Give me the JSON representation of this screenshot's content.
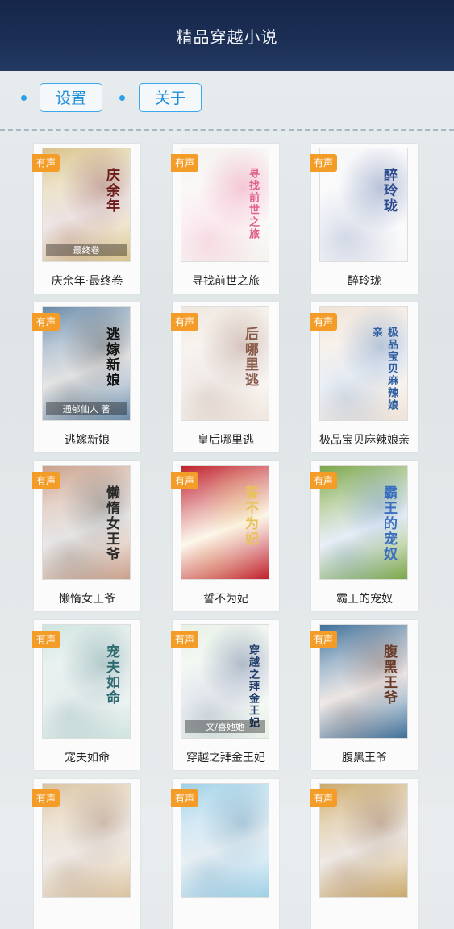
{
  "header": {
    "title": "精品穿越小说"
  },
  "toolbar": {
    "settings_label": "设置",
    "about_label": "关于"
  },
  "badge_label": "有声",
  "books": [
    {
      "title": "庆余年·最终卷",
      "cover_text": "庆余年",
      "cover_sub": "最终卷",
      "bg": "#d8c28a",
      "accent": "#6a1b1b"
    },
    {
      "title": "寻找前世之旅",
      "cover_text": "寻找前世之旅",
      "cover_sub": "",
      "bg": "#f4f1ee",
      "accent": "#e0608a"
    },
    {
      "title": "醉玲珑",
      "cover_text": "醉玲珑",
      "cover_sub": "",
      "bg": "#f6f6f8",
      "accent": "#2e4b8c"
    },
    {
      "title": "逃嫁新娘",
      "cover_text": "逃嫁新娘",
      "cover_sub": "通郁仙人 著",
      "bg": "#6a8aa8",
      "accent": "#111111"
    },
    {
      "title": "皇后哪里逃",
      "cover_text": "后哪里逃",
      "cover_sub": "",
      "bg": "#efe6dd",
      "accent": "#8a5b4a"
    },
    {
      "title": "极品宝贝麻辣娘亲",
      "cover_text": "极品宝贝麻辣娘亲",
      "cover_sub": "",
      "bg": "#efe2d6",
      "accent": "#2f5fa0"
    },
    {
      "title": "懒惰女王爷",
      "cover_text": "懒惰女王爷",
      "cover_sub": "",
      "bg": "#c9a08a",
      "accent": "#2a2a2a"
    },
    {
      "title": "誓不为妃",
      "cover_text": "誓不为妃",
      "cover_sub": "",
      "bg": "#c0222a",
      "accent": "#e8c25a"
    },
    {
      "title": "霸王的宠奴",
      "cover_text": "霸王的宠奴",
      "cover_sub": "",
      "bg": "#7aa64a",
      "accent": "#3a6fc0"
    },
    {
      "title": "宠夫如命",
      "cover_text": "宠夫如命",
      "cover_sub": "",
      "bg": "#cfe3df",
      "accent": "#2f6a70"
    },
    {
      "title": "穿越之拜金王妃",
      "cover_text": "穿越之拜金王妃",
      "cover_sub": "文/喜她她",
      "bg": "#e7f0e6",
      "accent": "#1f3b6a"
    },
    {
      "title": "腹黑王爷",
      "cover_text": "腹黑王爷",
      "cover_sub": "",
      "bg": "#3f6f98",
      "accent": "#6a3b2a"
    },
    {
      "title": "",
      "cover_text": "",
      "cover_sub": "",
      "bg": "#d9c2a0",
      "accent": "#7a5030"
    },
    {
      "title": "",
      "cover_text": "",
      "cover_sub": "",
      "bg": "#9fd0e6",
      "accent": "#2a6f9a"
    },
    {
      "title": "",
      "cover_text": "",
      "cover_sub": "",
      "bg": "#c9a86a",
      "accent": "#6a3a1a"
    }
  ],
  "colors": {
    "header_bg": "#1c2f55",
    "accent_blue": "#2aa0e8",
    "badge_orange": "#f39c28"
  },
  "icons": {
    "bullet": "dot-icon"
  }
}
